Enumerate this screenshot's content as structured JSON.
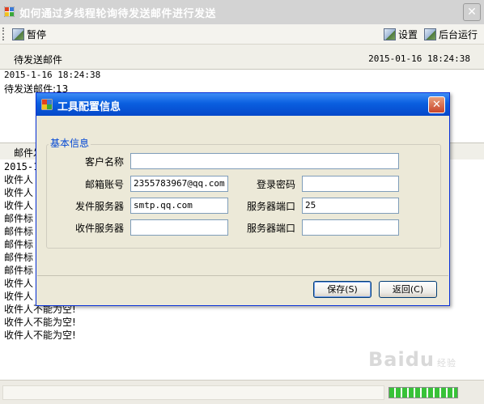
{
  "window": {
    "title": "如何通过多线程轮询待发送邮件进行发送"
  },
  "toolbar": {
    "pause_label": "暂停",
    "settings_label": "设置",
    "background_label": "后台运行"
  },
  "pending": {
    "header": "待发送邮件",
    "timestamp": "2015-01-16 18:24:38",
    "lines": [
      "2015-1-16 18:24:38",
      "待发送邮件:13"
    ]
  },
  "log": {
    "header": "邮件发",
    "lines": [
      "2015-1",
      "收件人",
      "收件人",
      "收件人",
      "邮件标",
      "邮件标",
      "邮件标",
      "邮件标",
      "邮件标",
      "收件人",
      "收件人",
      "收件人不能为空!",
      "收件人不能为空!",
      "收件人不能为空!"
    ]
  },
  "dialog": {
    "title": "工具配置信息",
    "group_title": "基本信息",
    "fields": {
      "client_name": {
        "label": "客户名称",
        "value": ""
      },
      "email_account": {
        "label": "邮箱账号",
        "value": "2355783967@qq.com"
      },
      "login_password": {
        "label": "登录密码",
        "value": ""
      },
      "send_server": {
        "label": "发件服务器",
        "value": "smtp.qq.com"
      },
      "send_port": {
        "label": "服务器端口",
        "value": "25"
      },
      "recv_server": {
        "label": "收件服务器",
        "value": ""
      },
      "recv_port": {
        "label": "服务器端口",
        "value": ""
      }
    },
    "save_label": "保存(S)",
    "back_label": "返回(C)"
  },
  "status": {
    "progress": 1.0
  },
  "watermark": {
    "text": "Baidu",
    "sub": "经验"
  },
  "colors": {
    "title_active": "#0a5fe0",
    "group_title": "#0046d5",
    "progress": "#38c238"
  }
}
